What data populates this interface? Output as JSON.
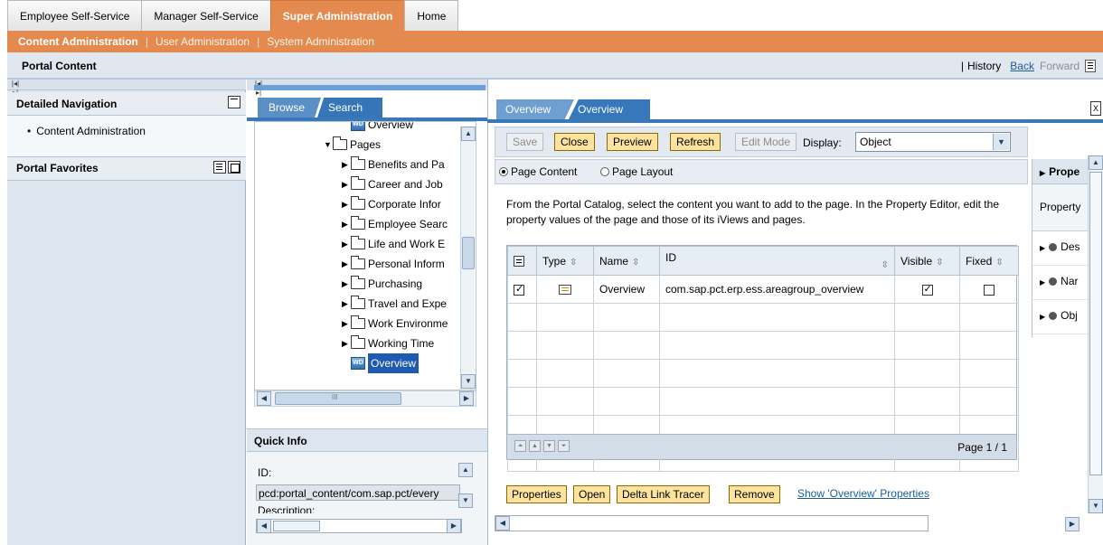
{
  "top_nav": {
    "tabs": [
      {
        "label": "Employee Self-Service",
        "active": false
      },
      {
        "label": "Manager Self-Service",
        "active": false
      },
      {
        "label": "Super Administration",
        "active": true
      },
      {
        "label": "Home",
        "active": false
      }
    ]
  },
  "second_nav": {
    "items": [
      {
        "label": "Content Administration",
        "active": true
      },
      {
        "label": "User Administration",
        "active": false
      },
      {
        "label": "System Administration",
        "active": false
      }
    ],
    "separator": "|"
  },
  "header": {
    "title": "Portal Content",
    "pipe": "|",
    "history": "History",
    "back": "Back",
    "forward": "Forward"
  },
  "left_nav": {
    "detailed_navigation": {
      "title": "Detailed Navigation",
      "items": [
        "Content Administration"
      ]
    },
    "portal_favorites": {
      "title": "Portal Favorites"
    }
  },
  "browser": {
    "tabs": [
      "Browse",
      "Search"
    ],
    "tree": [
      {
        "label": "Overview",
        "type": "iview",
        "indent": 5,
        "expanded": null
      },
      {
        "label": "Pages",
        "type": "folder",
        "indent": 4,
        "expanded": true
      },
      {
        "label": "Benefits and Pa",
        "type": "folder",
        "indent": 5,
        "expanded": false
      },
      {
        "label": "Career and Job",
        "type": "folder",
        "indent": 5,
        "expanded": false
      },
      {
        "label": "Corporate Infor",
        "type": "folder",
        "indent": 5,
        "expanded": false
      },
      {
        "label": "Employee Searc",
        "type": "folder",
        "indent": 5,
        "expanded": false
      },
      {
        "label": "Life and Work E",
        "type": "folder",
        "indent": 5,
        "expanded": false
      },
      {
        "label": "Personal Inform",
        "type": "folder",
        "indent": 5,
        "expanded": false
      },
      {
        "label": "Purchasing",
        "type": "folder",
        "indent": 5,
        "expanded": false
      },
      {
        "label": "Travel and Expe",
        "type": "folder",
        "indent": 5,
        "expanded": false
      },
      {
        "label": "Work Environme",
        "type": "folder",
        "indent": 5,
        "expanded": false
      },
      {
        "label": "Working Time",
        "type": "folder",
        "indent": 5,
        "expanded": false
      },
      {
        "label": "Overview",
        "type": "iview",
        "indent": 5,
        "expanded": null,
        "selected": true
      }
    ],
    "hscroll_glyph": "III"
  },
  "quick_info": {
    "title": "Quick Info",
    "id_label": "ID:",
    "id_value": "pcd:portal_content/com.sap.pct/every",
    "description_label": "Description:"
  },
  "editor": {
    "tabs": [
      "Overview",
      "Overview"
    ],
    "close_glyph": "X",
    "toolbar": {
      "save": "Save",
      "close": "Close",
      "preview": "Preview",
      "refresh": "Refresh",
      "edit_mode": "Edit Mode",
      "display_label": "Display:",
      "display_value": "Object"
    },
    "radios": [
      {
        "label": "Page Content",
        "selected": true
      },
      {
        "label": "Page Layout",
        "selected": false
      }
    ],
    "description": "From the Portal Catalog, select the content you want to add to the page. In the Property Editor, edit the property values of the page and those of its iViews and pages.",
    "table": {
      "columns": [
        "Type",
        "Name",
        "ID",
        "Visible",
        "Fixed"
      ],
      "rows": [
        {
          "type_icon": "iview-icon",
          "name": "Overview",
          "id": "com.sap.pct.erp.ess.areagroup_overview",
          "visible": true,
          "fixed": false,
          "selected": true
        }
      ],
      "empty_rows": 6,
      "page_label": "Page 1 / 1"
    },
    "actions": {
      "properties": "Properties",
      "open": "Open",
      "delta_link": "Delta Link Tracer",
      "remove": "Remove",
      "show_properties": "Show 'Overview' Properties"
    },
    "property_panel": {
      "title": "Prope",
      "sub": "Property",
      "rows": [
        "Des",
        "Nar",
        "Obj"
      ]
    }
  },
  "colors": {
    "brand_orange": "#e48a4f",
    "tab_blue": "#3777bb",
    "button_yellow": "#fde39e",
    "link_blue": "#1b5c9c"
  }
}
